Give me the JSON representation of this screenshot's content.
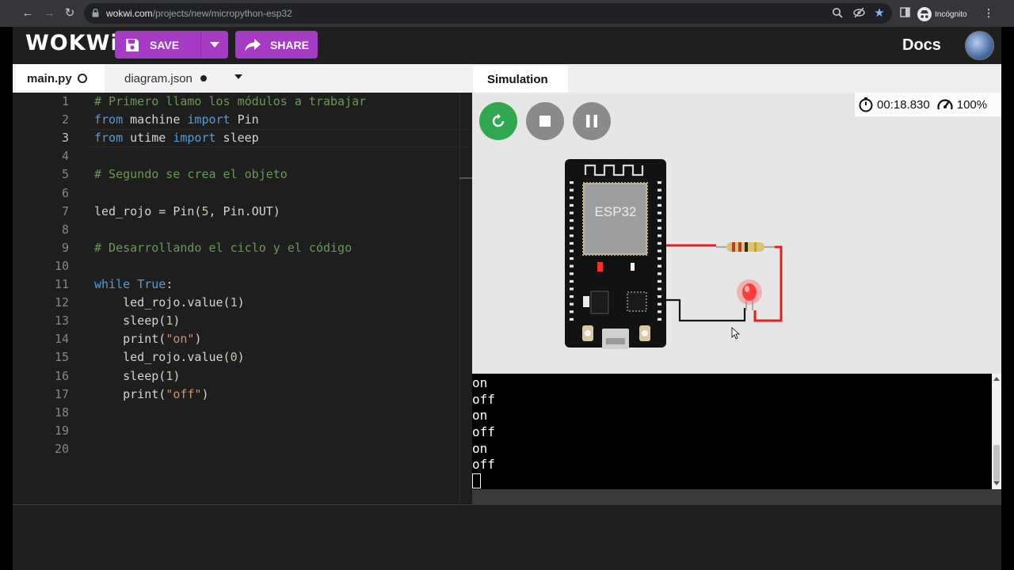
{
  "browser": {
    "url_host": "wokwi.com",
    "url_path": "/projects/new/micropython-esp32",
    "incognito_label": "Incógnito"
  },
  "header": {
    "logo": "WOKWi",
    "save_label": "SAVE",
    "share_label": "SHARE",
    "docs_label": "Docs"
  },
  "editor": {
    "tabs": [
      {
        "label": "main.py",
        "active": true
      },
      {
        "label": "diagram.json",
        "active": false
      }
    ],
    "current_line": 3,
    "lines": [
      {
        "n": "1",
        "text": "# Primero llamo los módulos a trabajar"
      },
      {
        "n": "2",
        "text": "from machine import Pin"
      },
      {
        "n": "3",
        "text": "from utime import sleep"
      },
      {
        "n": "4",
        "text": ""
      },
      {
        "n": "5",
        "text": "# Segundo se crea el objeto"
      },
      {
        "n": "6",
        "text": ""
      },
      {
        "n": "7",
        "text": "led_rojo = Pin(5, Pin.OUT)"
      },
      {
        "n": "8",
        "text": ""
      },
      {
        "n": "9",
        "text": "# Desarrollando el ciclo y el código"
      },
      {
        "n": "10",
        "text": ""
      },
      {
        "n": "11",
        "text": "while True:"
      },
      {
        "n": "12",
        "text": "    led_rojo.value(1)"
      },
      {
        "n": "13",
        "text": "    sleep(1)"
      },
      {
        "n": "14",
        "text": "    print(\"on\")"
      },
      {
        "n": "15",
        "text": "    led_rojo.value(0)"
      },
      {
        "n": "16",
        "text": "    sleep(1)"
      },
      {
        "n": "17",
        "text": "    print(\"off\")"
      },
      {
        "n": "18",
        "text": ""
      },
      {
        "n": "19",
        "text": ""
      },
      {
        "n": "20",
        "text": ""
      }
    ]
  },
  "simulation": {
    "tab_label": "Simulation",
    "elapsed": "00:18.830",
    "speed": "100%",
    "board_label": "ESP32",
    "serial_output": [
      "on",
      "off",
      "on",
      "off",
      "on",
      "off"
    ]
  },
  "colors": {
    "accent": "#a73cc4",
    "restart": "#2fa84f",
    "wire_red": "#e02020",
    "led_red": "#ff3b3b"
  }
}
